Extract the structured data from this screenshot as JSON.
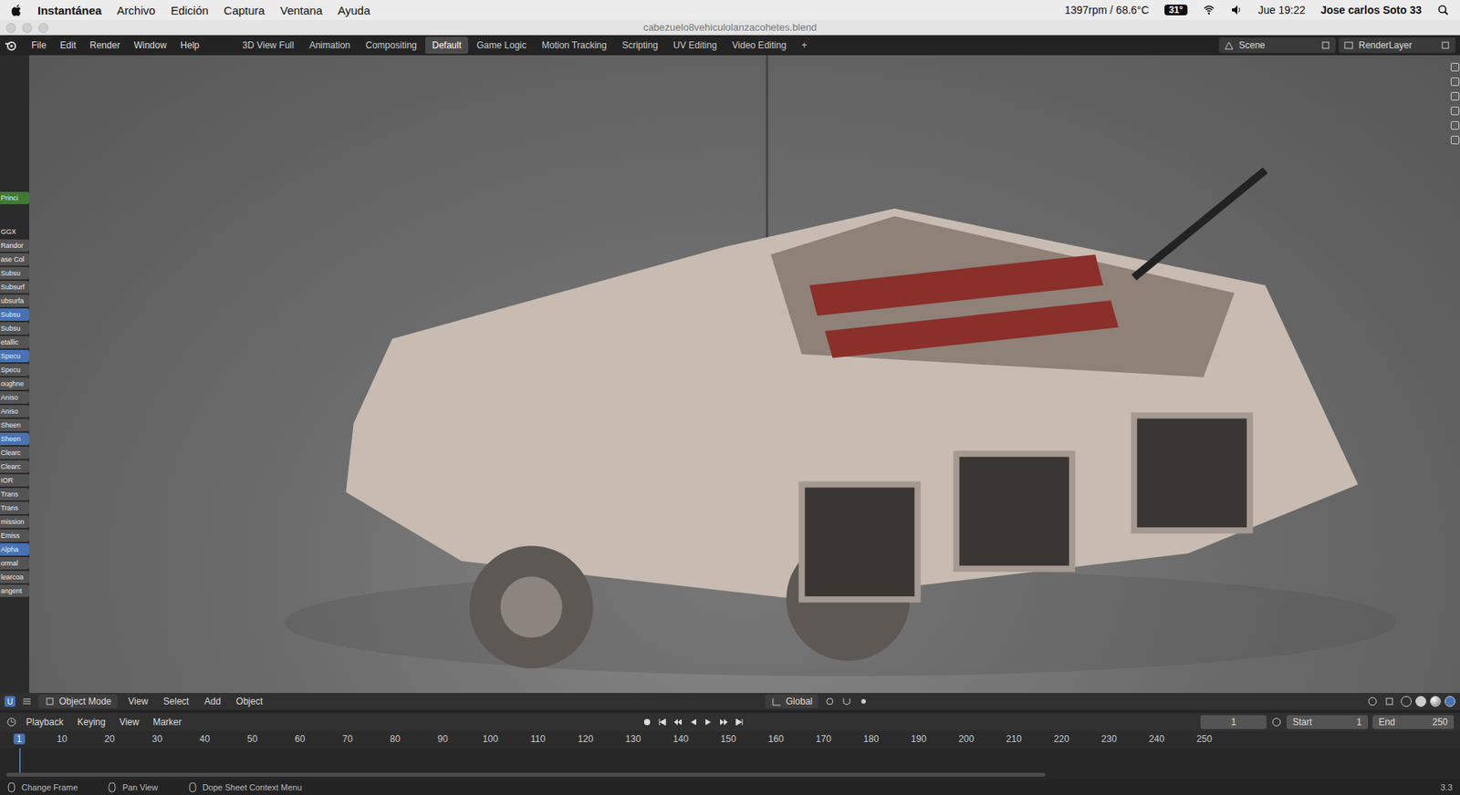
{
  "menubar": {
    "app": "Instantánea",
    "menus": [
      "Archivo",
      "Edición",
      "Captura",
      "Ventana",
      "Ayuda"
    ],
    "status": {
      "fan": "1397rpm / 68.6°C",
      "temp": "31°",
      "clock": "Jue 19:22",
      "user": "Jose carlos Soto 33"
    }
  },
  "window": {
    "title": "cabezuelo8vehiculolanzacohetes.blend"
  },
  "topbar": {
    "menus": [
      "File",
      "Edit",
      "Render",
      "Window",
      "Help"
    ],
    "workspaces": [
      {
        "label": "3D View Full",
        "selected": false
      },
      {
        "label": "Animation",
        "selected": false
      },
      {
        "label": "Compositing",
        "selected": false
      },
      {
        "label": "Default",
        "selected": true
      },
      {
        "label": "Game Logic",
        "selected": false
      },
      {
        "label": "Motion Tracking",
        "selected": false
      },
      {
        "label": "Scripting",
        "selected": false
      },
      {
        "label": "UV Editing",
        "selected": false
      },
      {
        "label": "Video Editing",
        "selected": false
      }
    ],
    "add": "+",
    "scene": "Scene",
    "render_layer": "RenderLayer"
  },
  "node_panel": {
    "items": [
      {
        "label": "Princi",
        "color": "#3f7a35"
      },
      {
        "label": "GGX",
        "color": "#2a2a2a"
      },
      {
        "label": "Randor",
        "color": "#545454"
      },
      {
        "label": "ase Col",
        "color": "#545454"
      },
      {
        "label": "Subsu",
        "color": "#545454"
      },
      {
        "label": "Subsurf",
        "color": "#545454"
      },
      {
        "label": "ubsurfa",
        "color": "#545454"
      },
      {
        "label": "Subsu",
        "color": "#4772b3"
      },
      {
        "label": "Subsu",
        "color": "#545454"
      },
      {
        "label": "etallic",
        "color": "#545454"
      },
      {
        "label": "Specu",
        "color": "#4772b3"
      },
      {
        "label": "Specu",
        "color": "#545454"
      },
      {
        "label": "oughne",
        "color": "#545454"
      },
      {
        "label": "Aniso",
        "color": "#545454"
      },
      {
        "label": "Aniso",
        "color": "#545454"
      },
      {
        "label": "Sheen",
        "color": "#545454"
      },
      {
        "label": "Sheen",
        "color": "#4772b3"
      },
      {
        "label": "Clearc",
        "color": "#545454"
      },
      {
        "label": "Clearc",
        "color": "#545454"
      },
      {
        "label": "IOR",
        "color": "#545454"
      },
      {
        "label": "Trans",
        "color": "#545454"
      },
      {
        "label": "Trans",
        "color": "#545454"
      },
      {
        "label": "mission",
        "color": "#545454"
      },
      {
        "label": "Emiss",
        "color": "#545454"
      },
      {
        "label": "Alpha",
        "color": "#4772b3"
      },
      {
        "label": "ormal",
        "color": "#545454"
      },
      {
        "label": "learcoa",
        "color": "#545454"
      },
      {
        "label": "angent",
        "color": "#545454"
      }
    ]
  },
  "viewport_header": {
    "layer_checkbox": {
      "label": "U",
      "checked": true
    },
    "mode": "Object Mode",
    "menus": [
      "View",
      "Select",
      "Add",
      "Object"
    ],
    "orientation": "Global"
  },
  "timeline_header": {
    "menus": [
      "Playback",
      "Keying",
      "View",
      "Marker"
    ],
    "current_frame": "1",
    "start_label": "Start",
    "start": "1",
    "end_label": "End",
    "end": "250"
  },
  "timeline_ruler": {
    "ticks": [
      {
        "label": "1",
        "selected": true
      },
      {
        "label": "10",
        "selected": false
      },
      {
        "label": "20",
        "selected": false
      },
      {
        "label": "30",
        "selected": false
      },
      {
        "label": "40",
        "selected": false
      },
      {
        "label": "50",
        "selected": false
      },
      {
        "label": "60",
        "selected": false
      },
      {
        "label": "70",
        "selected": false
      },
      {
        "label": "80",
        "selected": false
      },
      {
        "label": "90",
        "selected": false
      },
      {
        "label": "100",
        "selected": false
      },
      {
        "label": "110",
        "selected": false
      },
      {
        "label": "120",
        "selected": false
      },
      {
        "label": "130",
        "selected": false
      },
      {
        "label": "140",
        "selected": false
      },
      {
        "label": "150",
        "selected": false
      },
      {
        "label": "160",
        "selected": false
      },
      {
        "label": "170",
        "selected": false
      },
      {
        "label": "180",
        "selected": false
      },
      {
        "label": "190",
        "selected": false
      },
      {
        "label": "200",
        "selected": false
      },
      {
        "label": "210",
        "selected": false
      },
      {
        "label": "220",
        "selected": false
      },
      {
        "label": "230",
        "selected": false
      },
      {
        "label": "240",
        "selected": false
      },
      {
        "label": "250",
        "selected": false
      }
    ]
  },
  "status_bar": {
    "hints": [
      "Change Frame",
      "Pan View",
      "Dope Sheet Context Menu"
    ],
    "version": "3.3"
  }
}
